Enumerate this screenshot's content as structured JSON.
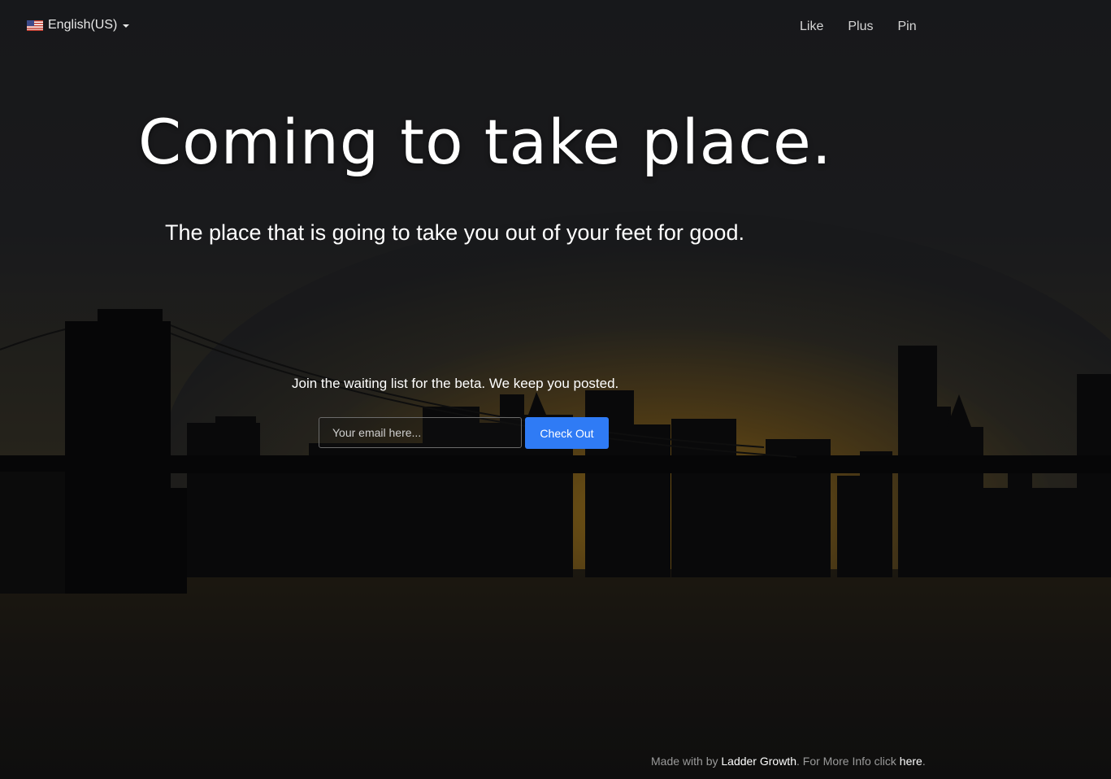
{
  "language": {
    "label": "English(US)",
    "flag_icon": "us-flag-icon"
  },
  "social": {
    "like": "Like",
    "plus": "Plus",
    "pin": "Pin"
  },
  "hero": {
    "headline": "Coming to take place.",
    "subheadline": "The place that is going to take you out of your feet for good."
  },
  "signup": {
    "prompt": "Join the waiting list for the beta. We keep you posted.",
    "email_placeholder": "Your email here...",
    "email_value": "",
    "button_label": "Check Out"
  },
  "footer": {
    "made_with": "Made with by",
    "company_link": "Ladder Growth",
    "more_info": ". For More Info click",
    "here_link": "here",
    "end": "."
  },
  "colors": {
    "accent": "#2f7bf5",
    "background": "#1c1d20",
    "sunset": "#e0a020"
  }
}
